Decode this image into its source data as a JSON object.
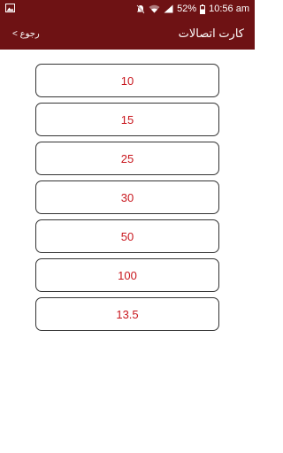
{
  "status_bar": {
    "battery": "52%",
    "time": "10:56 am",
    "icons": [
      "image-icon",
      "mute-icon",
      "wifi-icon",
      "signal-icon",
      "battery-icon"
    ]
  },
  "header": {
    "back_label": "رجوع >",
    "title": "كارت اتصالات",
    "bg_color": "#6e1214"
  },
  "options": [
    {
      "label": "10"
    },
    {
      "label": "15"
    },
    {
      "label": "25"
    },
    {
      "label": "30"
    },
    {
      "label": "50"
    },
    {
      "label": "100"
    },
    {
      "label": "13.5"
    }
  ],
  "accent_color": "#c8161d"
}
